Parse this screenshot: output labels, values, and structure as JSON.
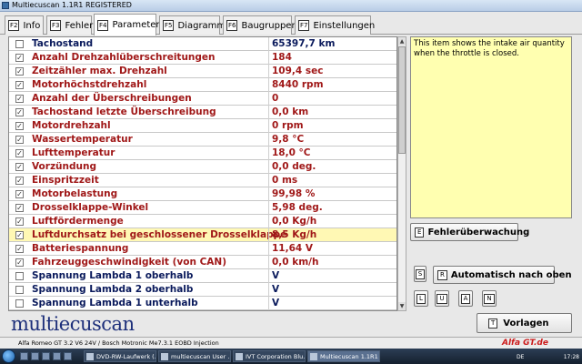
{
  "window": {
    "title": "Multiecuscan 1.1R1 REGISTERED"
  },
  "tabs": [
    {
      "key": "F2",
      "label": "Info",
      "active": false
    },
    {
      "key": "F3",
      "label": "Fehler",
      "active": false
    },
    {
      "key": "F4",
      "label": "Parameter",
      "active": true
    },
    {
      "key": "F5",
      "label": "Diagramm",
      "active": false
    },
    {
      "key": "F6",
      "label": "Baugruppen",
      "active": false
    },
    {
      "key": "F7",
      "label": "Einstellungen",
      "active": false
    }
  ],
  "parameters": [
    {
      "checked": false,
      "name": "Tachostand",
      "value": "65397,7 km",
      "color": "#0a1a5c"
    },
    {
      "checked": true,
      "name": "Anzahl Drehzahlüberschreitungen",
      "value": "184",
      "color": "#a01818"
    },
    {
      "checked": true,
      "name": "Zeitzähler max. Drehzahl",
      "value": "109,4 sec",
      "color": "#a01818"
    },
    {
      "checked": true,
      "name": "Motorhöchstdrehzahl",
      "value": "8440 rpm",
      "color": "#a01818"
    },
    {
      "checked": true,
      "name": "Anzahl der Überschreibungen",
      "value": "0",
      "color": "#a01818"
    },
    {
      "checked": true,
      "name": "Tachostand letzte Überschreibung",
      "value": "0,0 km",
      "color": "#a01818"
    },
    {
      "checked": true,
      "name": "Motordrehzahl",
      "value": "0 rpm",
      "color": "#a01818"
    },
    {
      "checked": true,
      "name": "Wassertemperatur",
      "value": "9,8 °C",
      "color": "#a01818"
    },
    {
      "checked": true,
      "name": "Lufttemperatur",
      "value": "18,0 °C",
      "color": "#a01818"
    },
    {
      "checked": true,
      "name": "Vorzündung",
      "value": "0,0 deg.",
      "color": "#a01818"
    },
    {
      "checked": true,
      "name": "Einspritzzeit",
      "value": "0 ms",
      "color": "#a01818"
    },
    {
      "checked": true,
      "name": "Motorbelastung",
      "value": "99,98 %",
      "color": "#a01818"
    },
    {
      "checked": true,
      "name": "Drosselklappe-Winkel",
      "value": "5,98 deg.",
      "color": "#a01818"
    },
    {
      "checked": true,
      "name": "Luftfördermenge",
      "value": "0,0 Kg/h",
      "color": "#a01818"
    },
    {
      "checked": true,
      "name": "Luftdurchsatz bei geschlossener Drosselklappe",
      "value": "8,5 Kg/h",
      "color": "#a01818",
      "highlight": true
    },
    {
      "checked": true,
      "name": "Batteriespannung",
      "value": "11,64 V",
      "color": "#a01818"
    },
    {
      "checked": true,
      "name": "Fahrzeuggeschwindigkeit (von CAN)",
      "value": "0,0 km/h",
      "color": "#a01818"
    },
    {
      "checked": false,
      "name": "Spannung Lambda 1 oberhalb",
      "value": "V",
      "color": "#0a1a5c"
    },
    {
      "checked": false,
      "name": "Spannung Lambda 2 oberhalb",
      "value": "V",
      "color": "#0a1a5c"
    },
    {
      "checked": false,
      "name": "Spannung Lambda 1 unterhalb",
      "value": "V",
      "color": "#0a1a5c"
    }
  ],
  "description": {
    "text": "This item shows the intake air quantity when the throttle is closed."
  },
  "buttons": {
    "fault_monitor": {
      "key": "E",
      "label": "Fehlerüberwachung"
    },
    "sort_s": {
      "key": "S"
    },
    "auto_top": {
      "key": "R",
      "label": "Automatisch nach oben"
    },
    "l": {
      "key": "L"
    },
    "u": {
      "key": "U"
    },
    "a": {
      "key": "A"
    },
    "n": {
      "key": "N"
    },
    "presets": {
      "key": "T",
      "label": "Vorlagen"
    }
  },
  "logo": {
    "text": "multiecuscan"
  },
  "status": {
    "text": "Alfa Romeo GT 3.2 V6 24V / Bosch Motronic Me7.3.1 EOBD Injection"
  },
  "taskbar": {
    "tasks": [
      {
        "label": "DVD-RW-Laufwerk (...",
        "active": false
      },
      {
        "label": "multiecuscan User ...",
        "active": false
      },
      {
        "label": "IVT Corporation Blu...",
        "active": false
      },
      {
        "label": "Multiecuscan 1.1R1 ...",
        "active": true
      }
    ],
    "language": "DE",
    "clock": "17:28",
    "watermark": "Alfa GT.de"
  },
  "colors": {
    "highlight_row": "#fff8b4",
    "description_bg": "#ffffb0",
    "logo": "#1d2f7a"
  }
}
